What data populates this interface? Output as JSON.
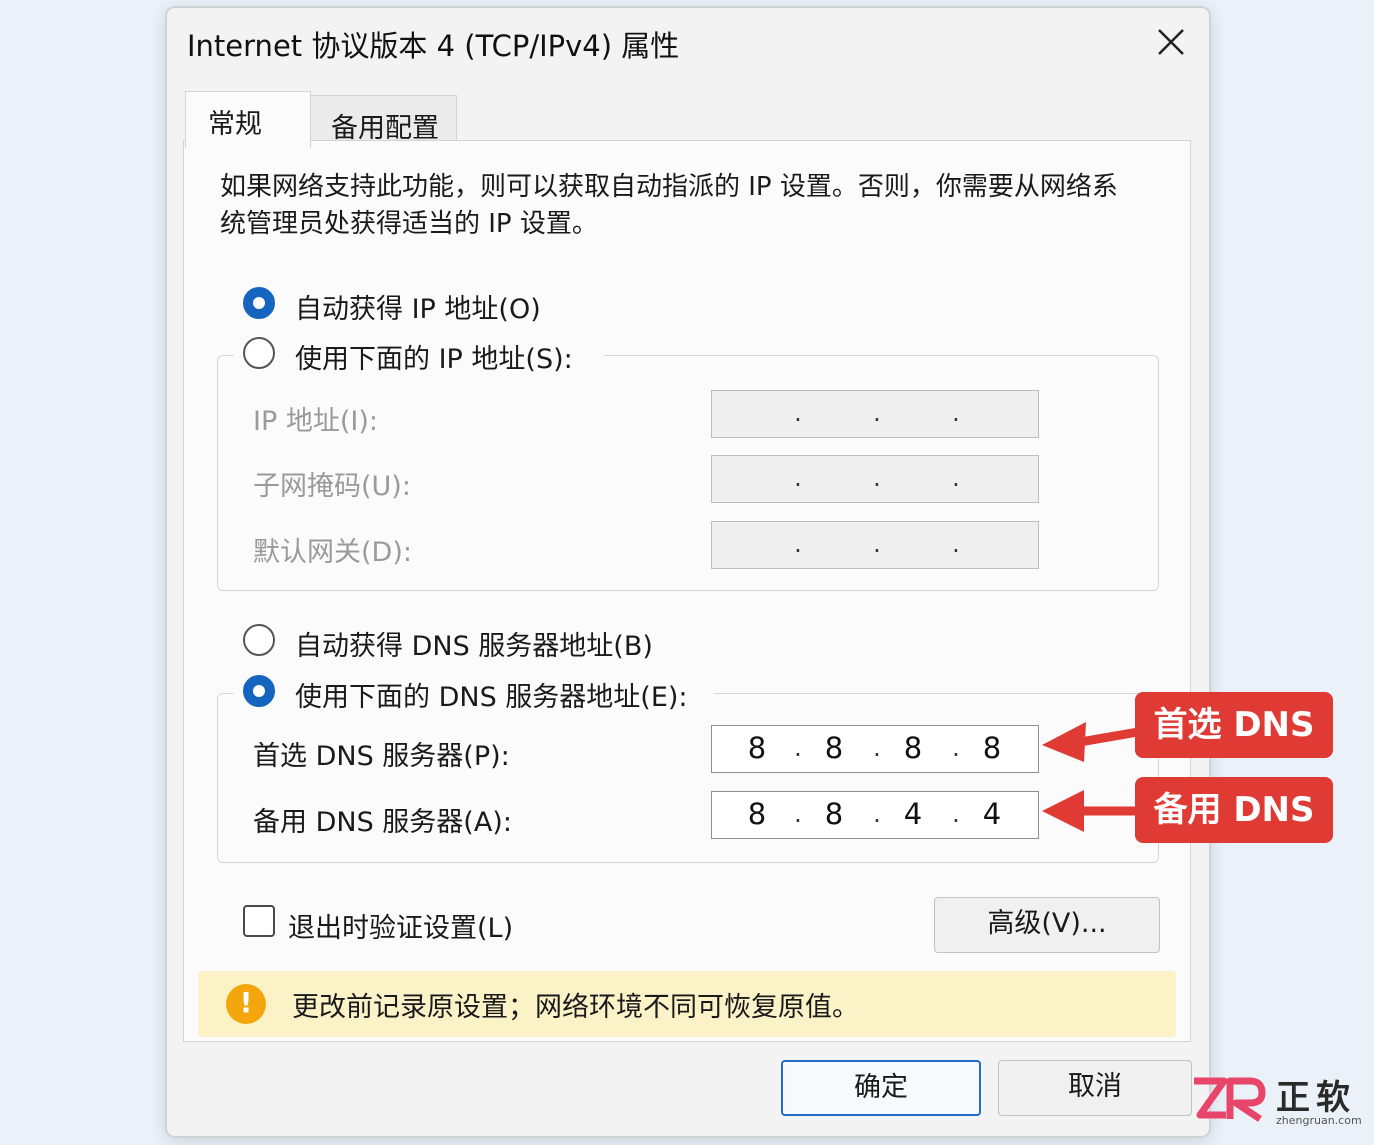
{
  "window": {
    "title": "Internet 协议版本 4 (TCP/IPv4) 属性"
  },
  "tabs": [
    {
      "label": "常规",
      "active": true
    },
    {
      "label": "备用配置",
      "active": false
    }
  ],
  "description": "如果网络支持此功能，则可以获取自动指派的 IP 设置。否则，你需要从网络系统管理员处获得适当的 IP 设置。",
  "ip": {
    "auto_label": "自动获得 IP 地址(O)",
    "auto_checked": true,
    "manual_label": "使用下面的 IP 地址(S):",
    "manual_checked": false,
    "fields": [
      {
        "label": "IP 地址(I):",
        "value": [
          "",
          "",
          "",
          ""
        ]
      },
      {
        "label": "子网掩码(U):",
        "value": [
          "",
          "",
          "",
          ""
        ]
      },
      {
        "label": "默认网关(D):",
        "value": [
          "",
          "",
          "",
          ""
        ]
      }
    ]
  },
  "dns": {
    "auto_label": "自动获得 DNS 服务器地址(B)",
    "auto_checked": false,
    "manual_label": "使用下面的 DNS 服务器地址(E):",
    "manual_checked": true,
    "fields": [
      {
        "label": "首选 DNS 服务器(P):",
        "value": [
          "8",
          "8",
          "8",
          "8"
        ]
      },
      {
        "label": "备用 DNS 服务器(A):",
        "value": [
          "8",
          "8",
          "4",
          "4"
        ]
      }
    ]
  },
  "validate": {
    "label": "退出时验证设置(L)",
    "checked": false
  },
  "advanced_button": "高级(V)...",
  "notice": {
    "text": "更改前记录原设置；网络环境不同可恢复原值。",
    "icon": "warning-icon"
  },
  "buttons": {
    "ok": "确定",
    "cancel": "取消"
  },
  "callouts": {
    "primary": "首选 DNS",
    "secondary": "备用 DNS",
    "color": "#e03a35"
  },
  "watermark": {
    "brand": "正软",
    "url": "zhengruan.com"
  },
  "colors": {
    "accent": "#1565c0",
    "notice_bg": "#fbf2c8",
    "warning": "#f3a70c"
  }
}
